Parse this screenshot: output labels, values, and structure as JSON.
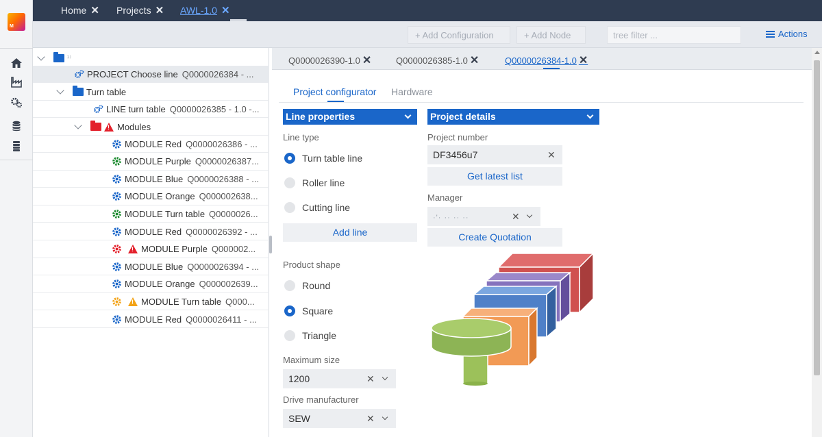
{
  "topbar": {
    "tabs": [
      {
        "label": "Home",
        "close": "✕"
      },
      {
        "label": "Projects",
        "close": "✕"
      },
      {
        "label": "AWL-1.0",
        "close": "✕"
      }
    ]
  },
  "toolbar": {
    "add_configuration": "+ Add Configuration",
    "add_node": "+ Add Node",
    "tree_filter_placeholder": "tree filter ...",
    "actions": "Actions"
  },
  "tree": {
    "root_label": "¹⁾",
    "project": {
      "label": "PROJECT Choose line",
      "code": "Q0000026384 - ..."
    },
    "turn_table": {
      "label": "Turn table"
    },
    "line": {
      "label": "LINE turn table",
      "code": "Q0000026385 - 1.0 -..."
    },
    "modules": {
      "label": "Modules"
    },
    "items": [
      {
        "label": "MODULE Red",
        "code": "Q0000026386 - ...",
        "status": "blue"
      },
      {
        "label": "MODULE Purple",
        "code": "Q0000026387...",
        "status": "green"
      },
      {
        "label": "MODULE Blue",
        "code": "Q0000026388 - ...",
        "status": "blue"
      },
      {
        "label": "MODULE Orange",
        "code": "Q000002638...",
        "status": "blue"
      },
      {
        "label": "MODULE Turn table",
        "code": "Q0000026...",
        "status": "green"
      },
      {
        "label": "MODULE Red",
        "code": "Q0000026392 - ...",
        "status": "blue"
      },
      {
        "label": "MODULE Purple",
        "code": "Q000002...",
        "status": "red"
      },
      {
        "label": "MODULE Blue",
        "code": "Q0000026394 - ...",
        "status": "blue"
      },
      {
        "label": "MODULE Orange",
        "code": "Q000002639...",
        "status": "blue"
      },
      {
        "label": "MODULE Turn table",
        "code": "Q000...",
        "status": "orange"
      },
      {
        "label": "MODULE Red",
        "code": "Q0000026411 - ...",
        "status": "blue"
      }
    ]
  },
  "doc_tabs": [
    {
      "label": "Q0000026390-1.0"
    },
    {
      "label": "Q0000026385-1.0"
    },
    {
      "label": "Q0000026384-1.0"
    }
  ],
  "subtabs": {
    "configurator": "Project configurator",
    "hardware": "Hardware"
  },
  "line_properties": {
    "header": "Line properties",
    "line_type_label": "Line type",
    "line_types": [
      "Turn table line",
      "Roller line",
      "Cutting line"
    ],
    "line_type_selected": 0,
    "add_line": "Add line",
    "product_shape_label": "Product shape",
    "shapes": [
      "Round",
      "Square",
      "Triangle"
    ],
    "shape_selected": 1,
    "max_size_label": "Maximum size",
    "max_size_value": "1200",
    "drive_label": "Drive manufacturer",
    "drive_value": "SEW"
  },
  "project_details": {
    "header": "Project details",
    "number_label": "Project number",
    "number_value": "DF3456u7",
    "get_latest": "Get latest list",
    "manager_label": "Manager",
    "manager_value": "·'· ·· ·· ··",
    "create_quotation": "Create Quotation"
  },
  "icons": {
    "clear": "✕",
    "close_bold": "✕"
  },
  "colors": {
    "accent": "#1a66c9",
    "topbar": "#2f3c51",
    "status_blue": "#1a66c9",
    "status_green": "#1a8a2e",
    "status_red": "#e3202b",
    "status_orange": "#f3a317"
  }
}
